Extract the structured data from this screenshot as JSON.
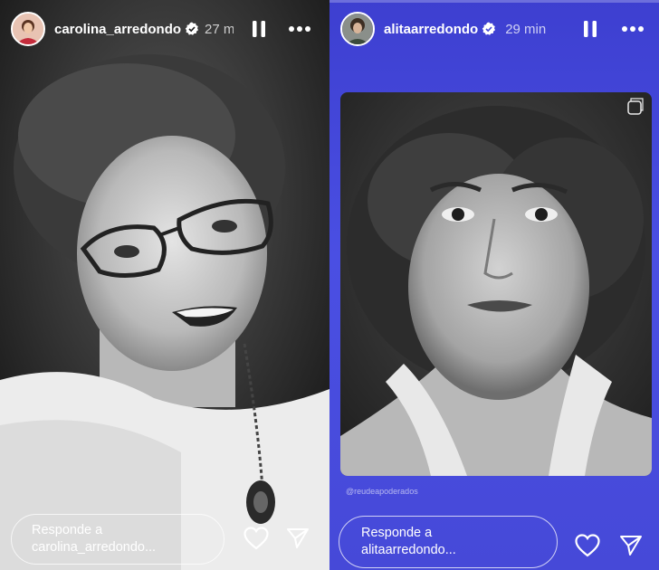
{
  "stories": [
    {
      "username": "carolina_arredondo",
      "time": "27 m",
      "reply_line1": "Responde a",
      "reply_line2": "carolina_arredondo...",
      "photo": "black-and-white-photo-of-woman-with-glasses-smiling"
    },
    {
      "username": "alitaarredondo",
      "time": "29 min",
      "reply_line1": "Responde a",
      "reply_line2": "alitaarredondo...",
      "photo": "black-and-white-portrait-of-woman-with-curly-hair",
      "credit": "@reudeapoderados"
    }
  ],
  "colors": {
    "left_background": "#1c1c1c",
    "right_background": "#4649d8",
    "verified_badge": "#ffffff"
  },
  "icons": {
    "pause": "pause-icon",
    "more": "more-options-icon",
    "like": "heart-icon",
    "share": "send-icon",
    "verified": "verified-badge-icon"
  }
}
